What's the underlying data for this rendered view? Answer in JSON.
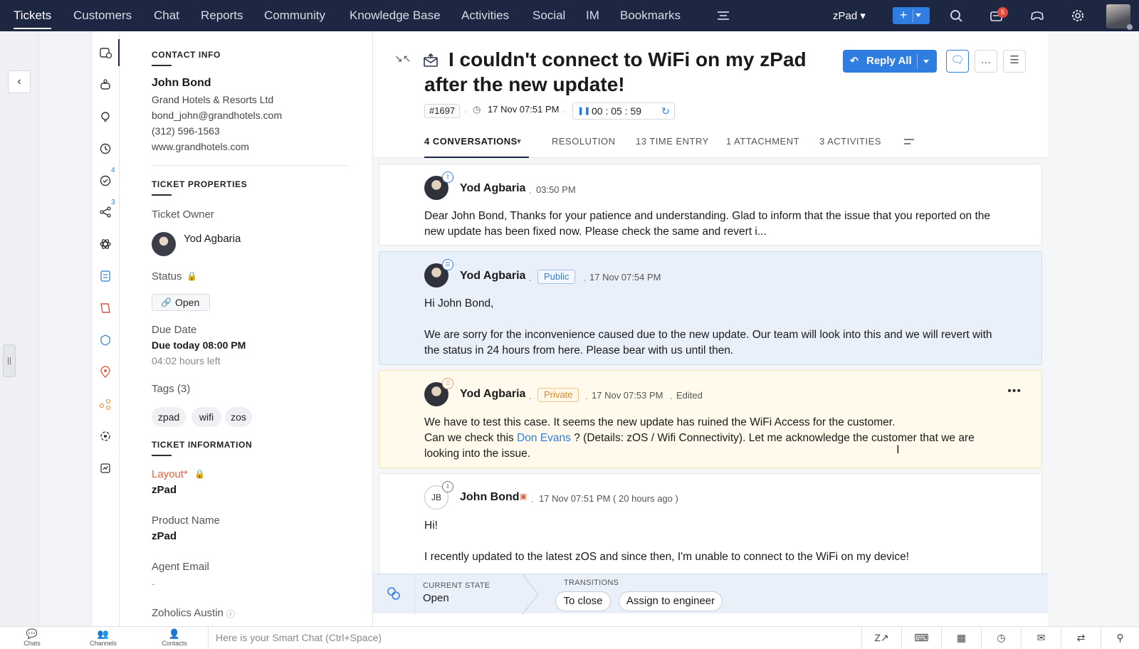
{
  "nav": {
    "tabs": [
      "Tickets",
      "Customers",
      "Chat",
      "Reports",
      "Community",
      "Knowledge Base",
      "Activities",
      "Social",
      "IM",
      "Bookmarks"
    ],
    "department": "zPad",
    "plus_label": "+",
    "notification_count": "5"
  },
  "rail": {
    "count_a": "4",
    "count_b": "3"
  },
  "contact": {
    "section_title": "CONTACT INFO",
    "name": "John Bond",
    "company": "Grand Hotels & Resorts Ltd",
    "email": "bond_john@grandhotels.com",
    "phone": "(312) 596-1563",
    "website": "www.grandhotels.com"
  },
  "properties": {
    "section_title": "TICKET PROPERTIES",
    "owner_label": "Ticket Owner",
    "owner_name": "Yod Agbaria",
    "status_label": "Status",
    "status_value": "Open",
    "due_label": "Due Date",
    "due_value": "Due today 08:00 PM",
    "due_left": "04:02 hours left",
    "tags_label": "Tags (3)",
    "tags": [
      "zpad",
      "wifi",
      "zos"
    ]
  },
  "information": {
    "section_title": "TICKET INFORMATION",
    "layout_label": "Layout",
    "layout_required": "*",
    "layout_value": "zPad",
    "product_label": "Product Name",
    "product_value": "zPad",
    "agent_email_label": "Agent Email",
    "agent_email_value": "-",
    "next_label": "Zoholics Austin"
  },
  "ticket": {
    "subject": "I couldn't connect to WiFi on my zPad after the new update!",
    "reply_label": "Reply All",
    "id": "#1697",
    "created": "17 Nov 07:51 PM",
    "timer": "00 : 05 : 59"
  },
  "tabs": {
    "conversations": "4 CONVERSATIONS",
    "resolution": "RESOLUTION",
    "time_entry": "13 TIME ENTRY",
    "attachment": "1 ATTACHMENT",
    "activities": "3 ACTIVITIES"
  },
  "conversations": [
    {
      "author": "Yod Agbaria",
      "time": "03:50 PM",
      "body": "Dear John Bond, Thanks for your patience and understanding. Glad to inform that the issue that you reported on the new update has been fixed now. Please check the same and revert i..."
    },
    {
      "author": "Yod Agbaria",
      "visibility": "Public",
      "time": "17 Nov 07:54 PM",
      "greeting": "Hi John Bond,",
      "body": "We are sorry for the inconvenience caused due to the new update. Our team will look into this and we will revert with the status in 24 hours from here. Please bear with us until then."
    },
    {
      "author": "Yod Agbaria",
      "visibility": "Private",
      "time": "17 Nov 07:53 PM",
      "edited": "Edited",
      "line1": "We have to test this case. It seems the new update has ruined the WiFi Access for the customer.",
      "line2_pre": "Can we check this ",
      "mention": "Don Evans",
      "line2_post": " ? (Details: zOS / Wifi Connectivity). Let me acknowledge the customer that we are looking into the issue."
    },
    {
      "author": "John Bond",
      "initials": "JB",
      "time": "17 Nov 07:51 PM ( 20 hours ago )",
      "greeting": "Hi!",
      "body": "I recently updated to the latest zOS and since then, I'm unable to connect to the WiFi on my device!"
    }
  ],
  "blueprint": {
    "current_state_label": "CURRENT STATE",
    "current_state": "Open",
    "transitions_label": "TRANSITIONS",
    "to_close": "To close",
    "assign": "Assign to engineer"
  },
  "bottom": {
    "chats": "Chats",
    "channels": "Channels",
    "contacts": "Contacts",
    "smart_chat_placeholder": "Here is your Smart Chat (Ctrl+Space)"
  },
  "colors": {
    "nav_bg": "#1d2742",
    "accent": "#2f7de1",
    "private": "#e08a2e",
    "required": "#e0623f"
  }
}
